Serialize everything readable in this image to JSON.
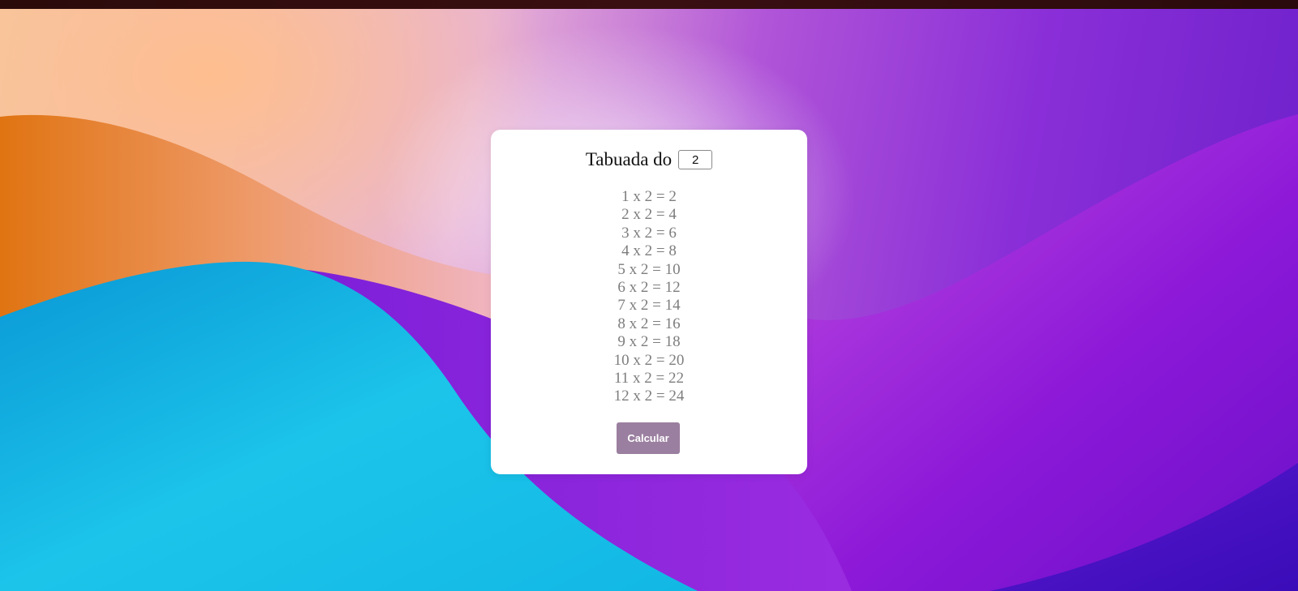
{
  "colors": {
    "card_background": "#ffffff",
    "button_background": "#9b7fa0",
    "button_text": "#ffffff",
    "result_text": "#7d7d7d",
    "title_text": "#111111"
  },
  "card": {
    "title_label": "Tabuada do",
    "input": {
      "value": "2"
    },
    "results": [
      "1 x 2 = 2",
      "2 x 2 = 4",
      "3 x 2 = 6",
      "4 x 2 = 8",
      "5 x 2 = 10",
      "6 x 2 = 12",
      "7 x 2 = 14",
      "8 x 2 = 16",
      "9 x 2 = 18",
      "10 x 2 = 20",
      "11 x 2 = 22",
      "12 x 2 = 24"
    ],
    "button_label": "Calcular"
  }
}
